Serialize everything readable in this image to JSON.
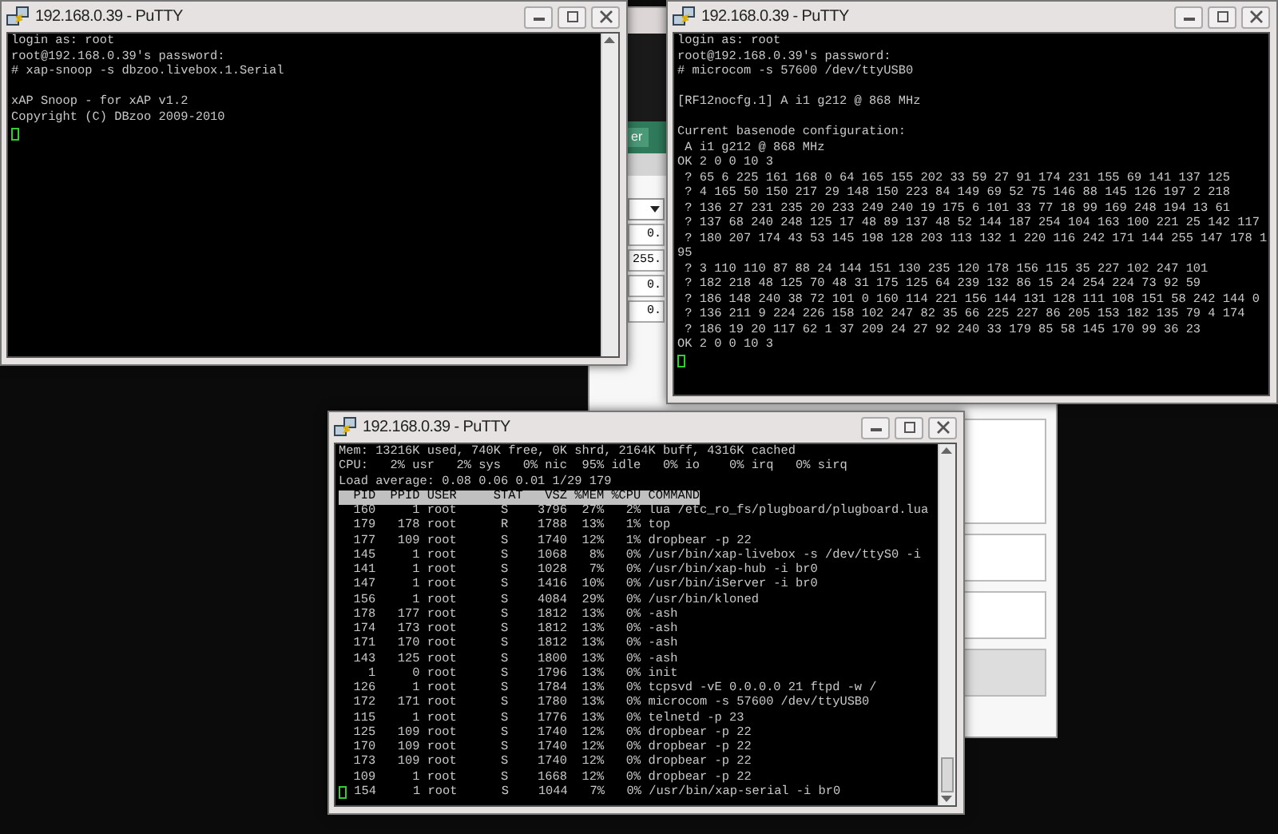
{
  "background_window": {
    "tab_label": "er",
    "ip_fields": [
      "0.",
      "255.",
      "0.",
      "0."
    ]
  },
  "windows": [
    {
      "title": "192.168.0.39 - PuTTY",
      "blocks": [
        [
          "login as: root",
          "root@192.168.0.39's password:",
          "# xap-snoop -s dbzoo.livebox.1.Serial"
        ],
        [
          "xAP Snoop - for xAP v1.2",
          "Copyright (C) DBzoo 2009-2010"
        ]
      ]
    },
    {
      "title": "192.168.0.39 - PuTTY",
      "blocks": [
        [
          "login as: root",
          "root@192.168.0.39's password:",
          "# microcom -s 57600 /dev/ttyUSB0"
        ],
        [
          "[RF12nocfg.1] A i1 g212 @ 868 MHz"
        ],
        [
          "Current basenode configuration:",
          " A i1 g212 @ 868 MHz",
          "OK 2 0 0 10 3",
          " ? 65 6 225 161 168 0 64 165 155 202 33 59 27 91 174 231 155 69 141 137 125",
          " ? 4 165 50 150 217 29 148 150 223 84 149 69 52 75 146 88 145 126 197 2 218",
          " ? 136 27 231 235 20 233 249 240 19 175 6 101 33 77 18 99 169 248 194 13 61",
          " ? 137 68 240 248 125 17 48 89 137 48 52 144 187 254 104 163 100 221 25 142 117",
          " ? 180 207 174 43 53 145 198 128 203 113 132 1 220 116 242 171 144 255 147 178 1",
          "95",
          " ? 3 110 110 87 88 24 144 151 130 235 120 178 156 115 35 227 102 247 101",
          " ? 182 218 48 125 70 48 31 175 125 64 239 132 86 15 24 254 224 73 92 59",
          " ? 186 148 240 38 72 101 0 160 114 221 156 144 131 128 111 108 151 58 242 144 0",
          " ? 136 211 9 224 226 158 102 247 82 35 66 225 227 86 205 153 182 135 79 4 174",
          " ? 186 19 20 117 62 1 37 209 24 27 92 240 33 179 85 58 145 170 99 36 23",
          "OK 2 0 0 10 3"
        ]
      ]
    },
    {
      "title": "192.168.0.39 - PuTTY",
      "summary": [
        "Mem: 13216K used, 740K free, 0K shrd, 2164K buff, 4316K cached",
        "CPU:   2% usr   2% sys   0% nic  95% idle   0% io    0% irq   0% sirq",
        "Load average: 0.08 0.06 0.01 1/29 179"
      ],
      "process_header": "  PID  PPID USER     STAT   VSZ %MEM %CPU COMMAND",
      "blocks": [
        [
          "  160     1 root      S    3796  27%   2% lua /etc_ro_fs/plugboard/plugboard.lua",
          "  179   178 root      R    1788  13%   1% top",
          "  177   109 root      S    1740  12%   1% dropbear -p 22",
          "  145     1 root      S    1068   8%   0% /usr/bin/xap-livebox -s /dev/ttyS0 -i",
          "  141     1 root      S    1028   7%   0% /usr/bin/xap-hub -i br0",
          "  147     1 root      S    1416  10%   0% /usr/bin/iServer -i br0",
          "  156     1 root      S    4084  29%   0% /usr/bin/kloned",
          "  178   177 root      S    1812  13%   0% -ash",
          "  174   173 root      S    1812  13%   0% -ash",
          "  171   170 root      S    1812  13%   0% -ash",
          "  143   125 root      S    1800  13%   0% -ash",
          "    1     0 root      S    1796  13%   0% init",
          "  126     1 root      S    1784  13%   0% tcpsvd -vE 0.0.0.0 21 ftpd -w /",
          "  172   171 root      S    1780  13%   0% microcom -s 57600 /dev/ttyUSB0",
          "  115     1 root      S    1776  13%   0% telnetd -p 23",
          "  125   109 root      S    1740  12%   0% dropbear -p 22",
          "  170   109 root      S    1740  12%   0% dropbear -p 22",
          "  173   109 root      S    1740  12%   0% dropbear -p 22",
          "  109     1 root      S    1668  12%   0% dropbear -p 22",
          " 154     1 root      S    1044   7%   0% /usr/bin/xap-serial -i br0"
        ]
      ]
    }
  ]
}
